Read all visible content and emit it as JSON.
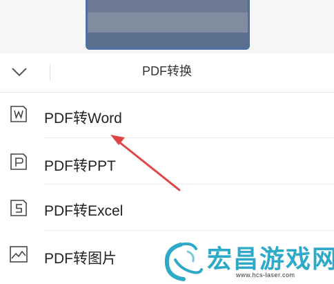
{
  "header": {
    "title": "PDF转换"
  },
  "menu": [
    {
      "label": "PDF转Word",
      "icon": "word-document-icon"
    },
    {
      "label": "PDF转PPT",
      "icon": "ppt-document-icon"
    },
    {
      "label": "PDF转Excel",
      "icon": "excel-document-icon"
    },
    {
      "label": "PDF转图片",
      "icon": "image-icon"
    }
  ],
  "watermark": {
    "text": "宏昌游戏网",
    "url": "www.hcs-laser.com"
  },
  "colors": {
    "annotation_arrow": "#e04545",
    "watermark": "#2ea9c8",
    "preview_border": "#4f6fa1"
  }
}
